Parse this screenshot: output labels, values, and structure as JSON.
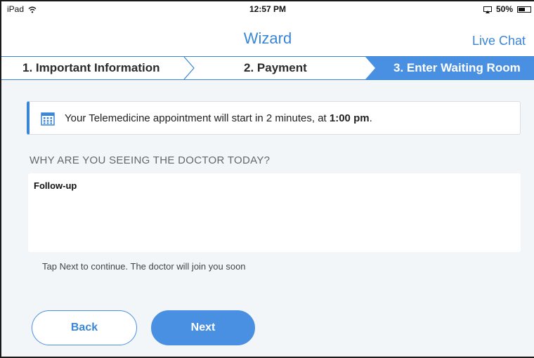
{
  "status_bar": {
    "device": "iPad",
    "time": "12:57 PM",
    "battery": "50%"
  },
  "nav": {
    "title": "Wizard",
    "live_chat": "Live Chat"
  },
  "steps": [
    {
      "label": "1. Important Information",
      "state": "done"
    },
    {
      "label": "2. Payment",
      "state": "done"
    },
    {
      "label": "3. Enter Waiting Room",
      "state": "active"
    }
  ],
  "banner": {
    "text_prefix": "Your Telemedicine appointment will start in 2 minutes, at ",
    "time": "1:00 pm",
    "text_suffix": ".",
    "icon": "calendar-icon"
  },
  "form": {
    "question": "WHY ARE YOU SEEING THE DOCTOR TODAY?",
    "answer": "Follow-up",
    "hint": "Tap Next to continue. The doctor will join you soon"
  },
  "buttons": {
    "back": "Back",
    "next": "Next"
  },
  "colors": {
    "accent": "#4a90e2",
    "background": "#f2f6f9"
  }
}
